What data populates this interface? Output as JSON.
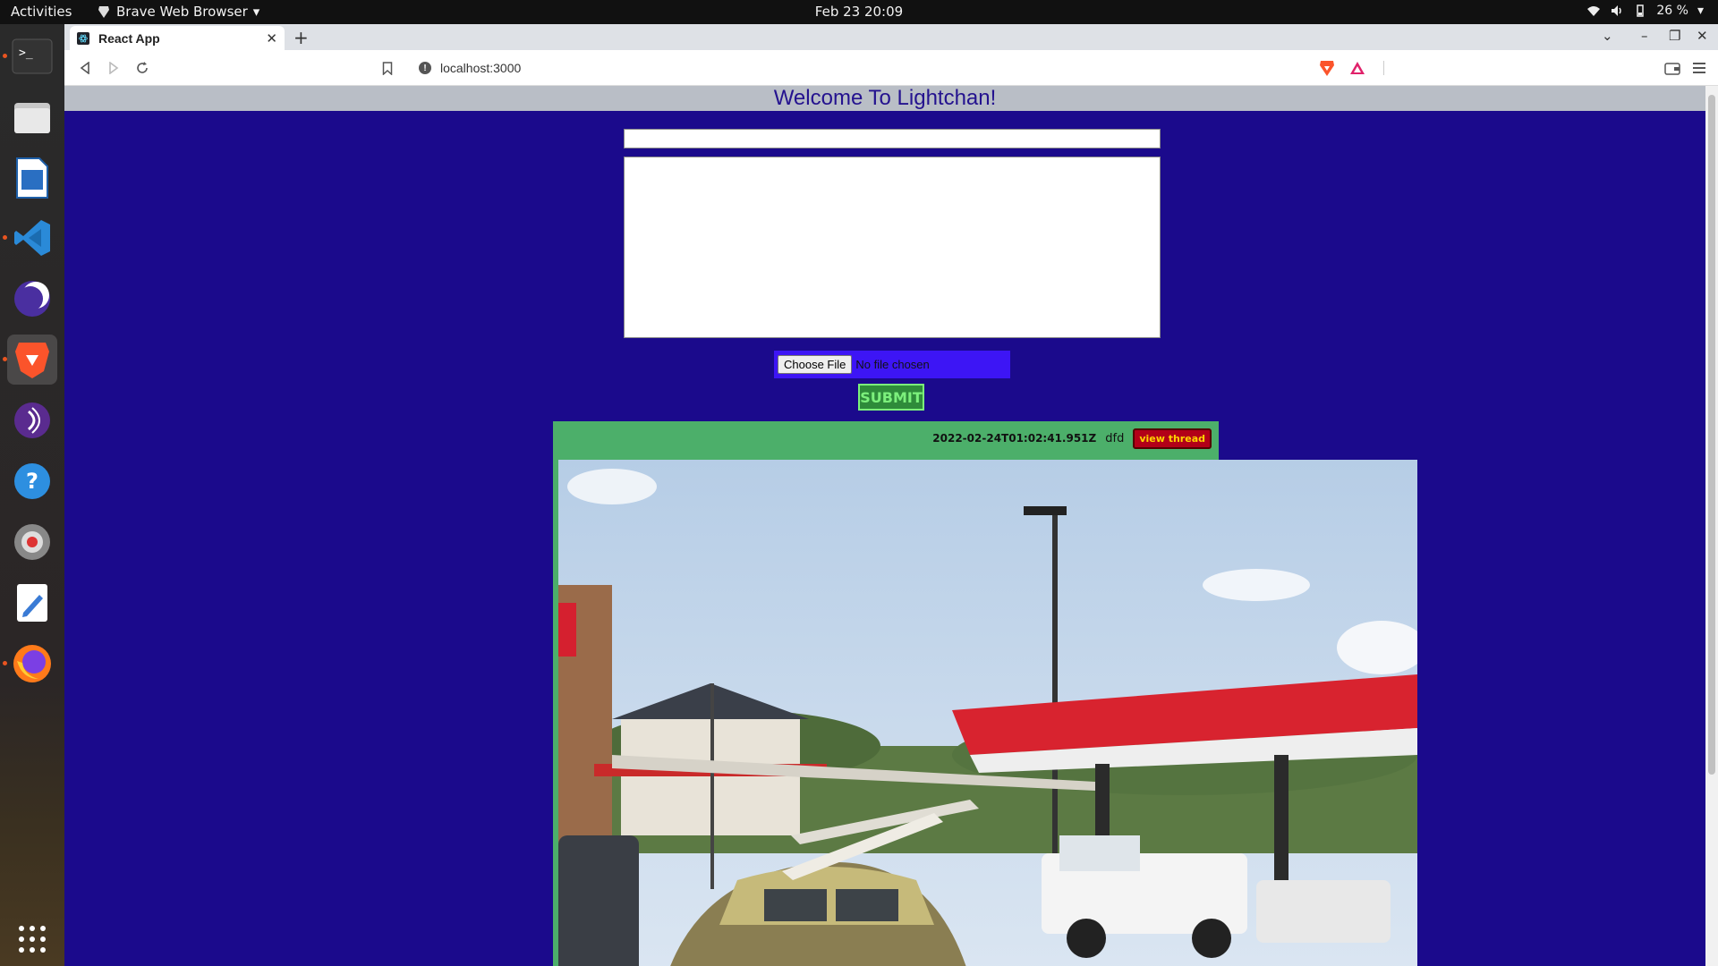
{
  "system": {
    "activities": "Activities",
    "app_menu": "Brave Web Browser",
    "clock": "Feb 23  20:09",
    "battery": "26 %"
  },
  "browser": {
    "tab_title": "React App",
    "url": "localhost:3000"
  },
  "page": {
    "title": "Welcome To Lightchan!",
    "file_button": "Choose File",
    "file_status": "No file chosen",
    "submit_label": "SUBMIT",
    "post": {
      "timestamp": "2022-02-24T01:02:41.951Z",
      "author": "dfd",
      "view_thread_label": "view thread"
    }
  },
  "colors": {
    "page_bg": "#1b0a8c",
    "post_bg": "#4caf6a",
    "view_thread_bg": "#b20018",
    "submit_bg": "#2e8b3a"
  }
}
